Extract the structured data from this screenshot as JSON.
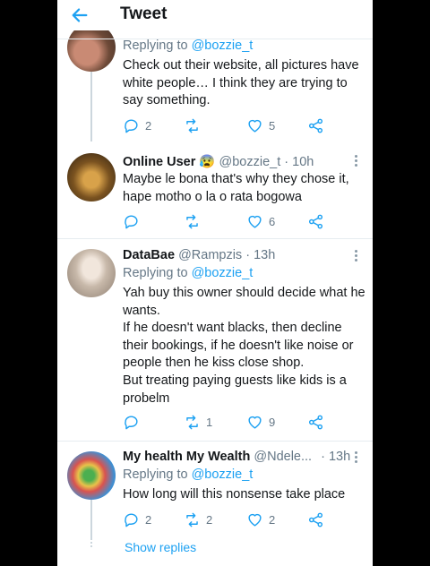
{
  "header": {
    "title": "Tweet"
  },
  "tweets": [
    {
      "replying_label": "Replying to",
      "replying_handle": "@bozzie_t",
      "text": "Check out their website, all pictures have white people… I think they are trying to say something.",
      "reply_count": "2",
      "retweet_count": "",
      "like_count": "5"
    },
    {
      "name": "Online User",
      "emoji": "😰",
      "handle": "@bozzie_t",
      "time": "· 10h",
      "text": "Maybe le bona that's why they chose it, hape motho o la o rata bogowa",
      "reply_count": "",
      "retweet_count": "",
      "like_count": "6"
    },
    {
      "name": "DataBae",
      "handle": "@Rampzis",
      "time": "· 13h",
      "replying_label": "Replying to",
      "replying_handle": "@bozzie_t",
      "text": "Yah buy this owner should decide what he wants.\nIf he doesn't want blacks, then decline their bookings,  if he doesn't like noise or people then he kiss close shop.\nBut treating paying guests like kids is a probelm",
      "reply_count": "",
      "retweet_count": "1",
      "like_count": "9"
    },
    {
      "name": "My health My Wealth",
      "handle": "@Ndele...",
      "time": "· 13h",
      "replying_label": "Replying to",
      "replying_handle": "@bozzie_t",
      "text": "How long will this nonsense take place",
      "reply_count": "2",
      "retweet_count": "2",
      "like_count": "2"
    }
  ],
  "show_replies": "Show replies",
  "colors": {
    "accent": "#1da1f2",
    "text": "#14171a",
    "muted": "#657786",
    "divider": "#e6ecf0"
  }
}
